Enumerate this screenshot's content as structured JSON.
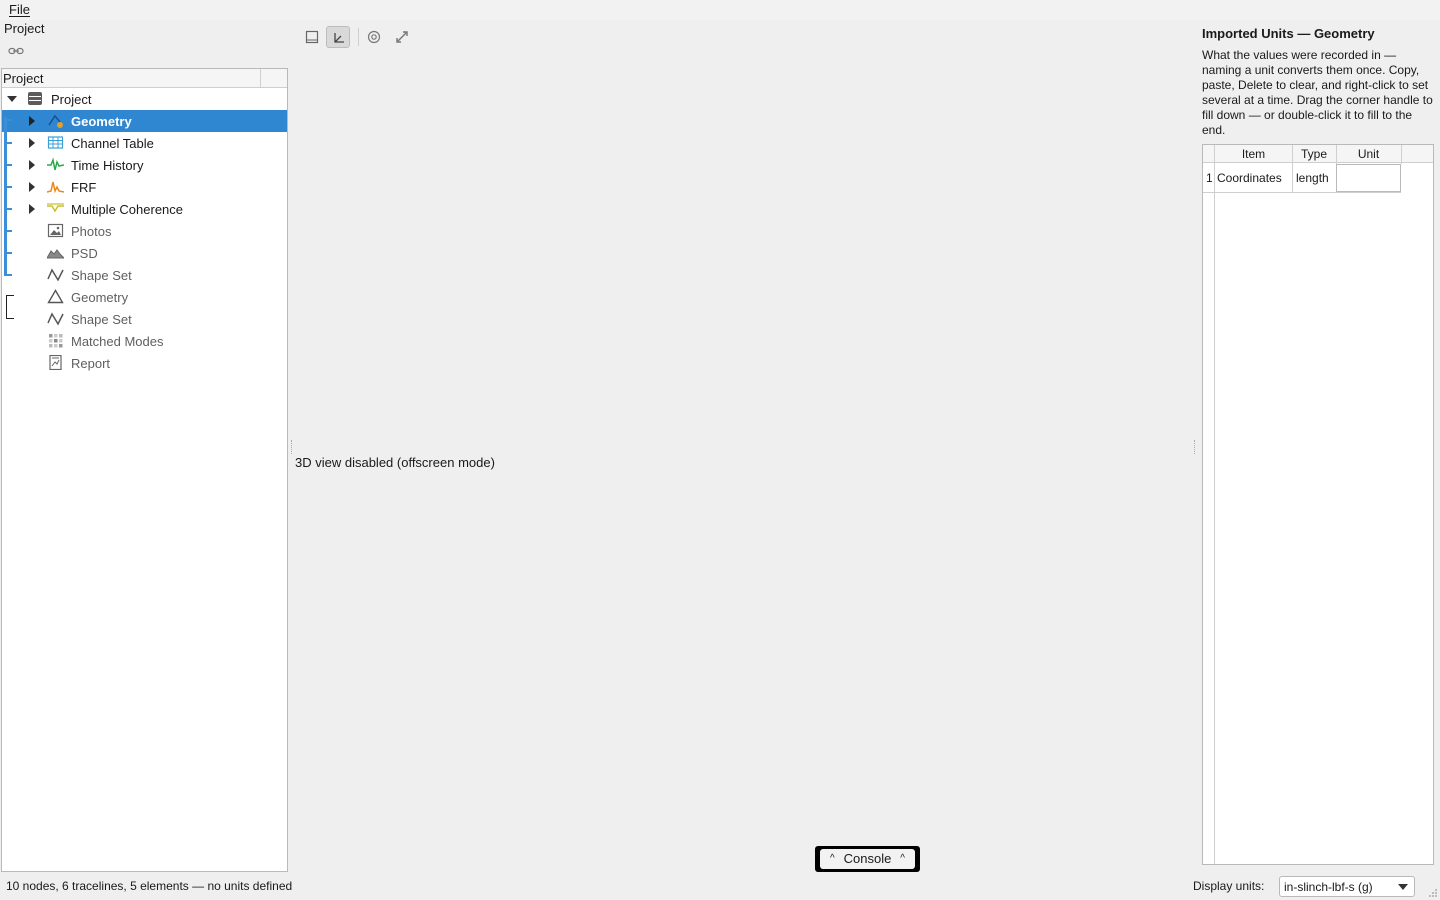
{
  "menubar": {
    "file_label": "File"
  },
  "project_panel": {
    "title": "Project",
    "tree_header": "Project",
    "items": [
      {
        "label": "Project",
        "icon": "database-icon"
      },
      {
        "label": "Geometry",
        "icon": "geometry-edit-icon",
        "selected": true
      },
      {
        "label": "Channel Table",
        "icon": "table-icon"
      },
      {
        "label": "Time History",
        "icon": "waveform-icon"
      },
      {
        "label": "FRF",
        "icon": "frf-peak-icon"
      },
      {
        "label": "Multiple Coherence",
        "icon": "coherence-icon"
      },
      {
        "label": "Photos",
        "icon": "photo-icon"
      },
      {
        "label": "PSD",
        "icon": "psd-icon"
      },
      {
        "label": "Shape Set",
        "icon": "shape-wave-icon"
      },
      {
        "label": "Geometry",
        "icon": "triangle-icon"
      },
      {
        "label": "Shape Set",
        "icon": "shape-wave-icon"
      },
      {
        "label": "Matched Modes",
        "icon": "grid-icon"
      },
      {
        "label": "Report",
        "icon": "report-icon"
      }
    ]
  },
  "viewer": {
    "message": "3D view disabled (offscreen mode)"
  },
  "console": {
    "label": "Console"
  },
  "units_panel": {
    "title": "Imported Units — Geometry",
    "description": "What the values were recorded in — naming a unit converts them once. Copy, paste, Delete to clear, and right-click to set several at a time. Drag the corner handle to fill down — or double-click it to fill to the end.",
    "columns": [
      "Item",
      "Type",
      "Unit"
    ],
    "rows": [
      {
        "num": "1",
        "item": "Coordinates",
        "type": "length",
        "unit": ""
      }
    ]
  },
  "status": {
    "text": "10 nodes, 6 tracelines, 5 elements — no units defined",
    "display_units_label": "Display units:",
    "display_units_value": "in-slinch-lbf-s (g)"
  },
  "colors": {
    "selection": "#2f86d1",
    "accent": "#3a8fd8"
  }
}
